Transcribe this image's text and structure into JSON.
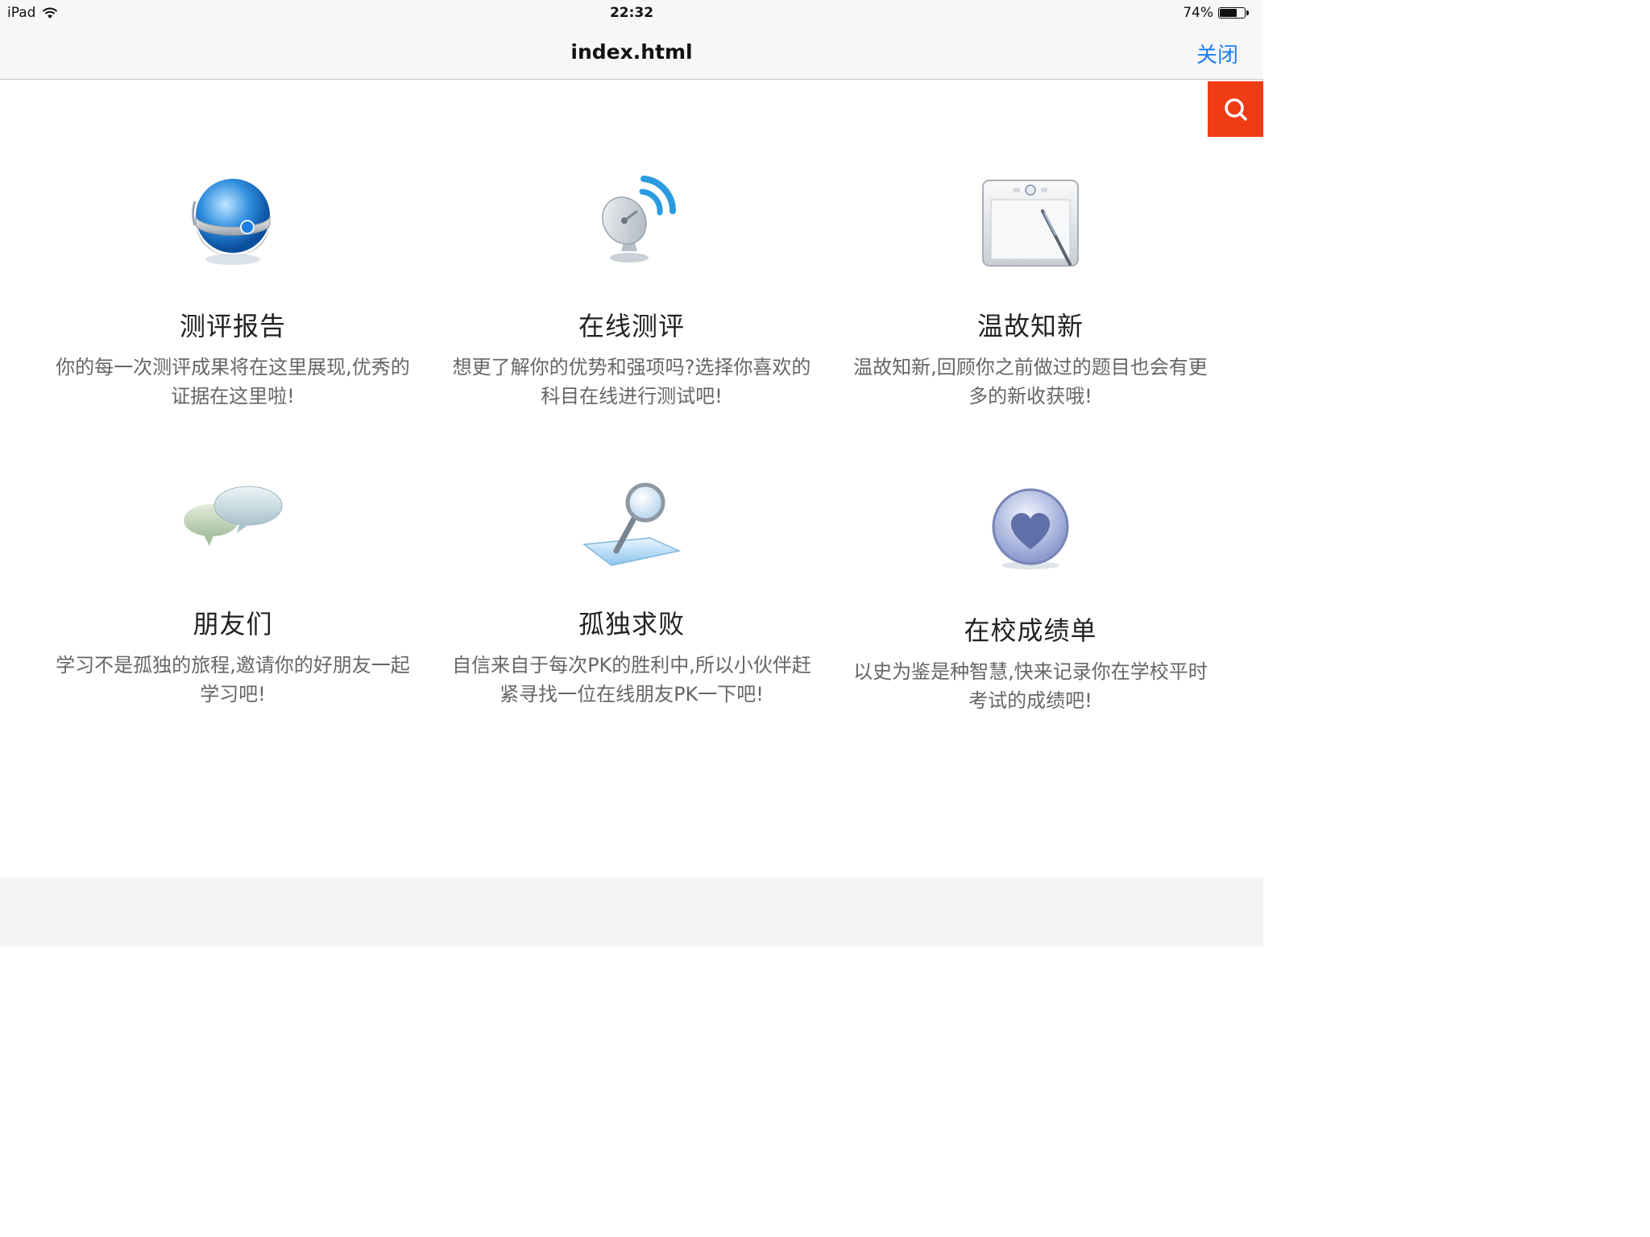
{
  "status_bar": {
    "device": "iPad",
    "time": "22:32",
    "battery": "74%",
    "battery_level": 0.74
  },
  "nav": {
    "title": "index.html",
    "close_label": "关闭"
  },
  "search": {
    "icon": "search-icon",
    "color": "#f03c14"
  },
  "cards": [
    {
      "title": "测评报告",
      "desc": "你的每一次测评成果将在这里展现,优秀的证据在这里啦!",
      "icon": "globe-icon"
    },
    {
      "title": "在线测评",
      "desc": "想更了解你的优势和强项吗?选择你喜欢的科目在线进行测试吧!",
      "icon": "satellite-dish-icon"
    },
    {
      "title": "温故知新",
      "desc": "温故知新,回顾你之前做过的题目也会有更多的新收获哦!",
      "icon": "drawing-tablet-icon"
    },
    {
      "title": "朋友们",
      "desc": "学习不是孤独的旅程,邀请你的好朋友一起学习吧!",
      "icon": "chat-bubbles-icon"
    },
    {
      "title": "孤独求败",
      "desc": "自信来自于每次PK的胜利中,所以小伙伴赶紧寻找一位在线朋友PK一下吧!",
      "icon": "magnifier-icon"
    },
    {
      "title": "在校成绩单",
      "desc": "以史为鉴是种智慧,快来记录你在学校平时考试的成绩吧!",
      "icon": "heart-badge-icon"
    }
  ]
}
